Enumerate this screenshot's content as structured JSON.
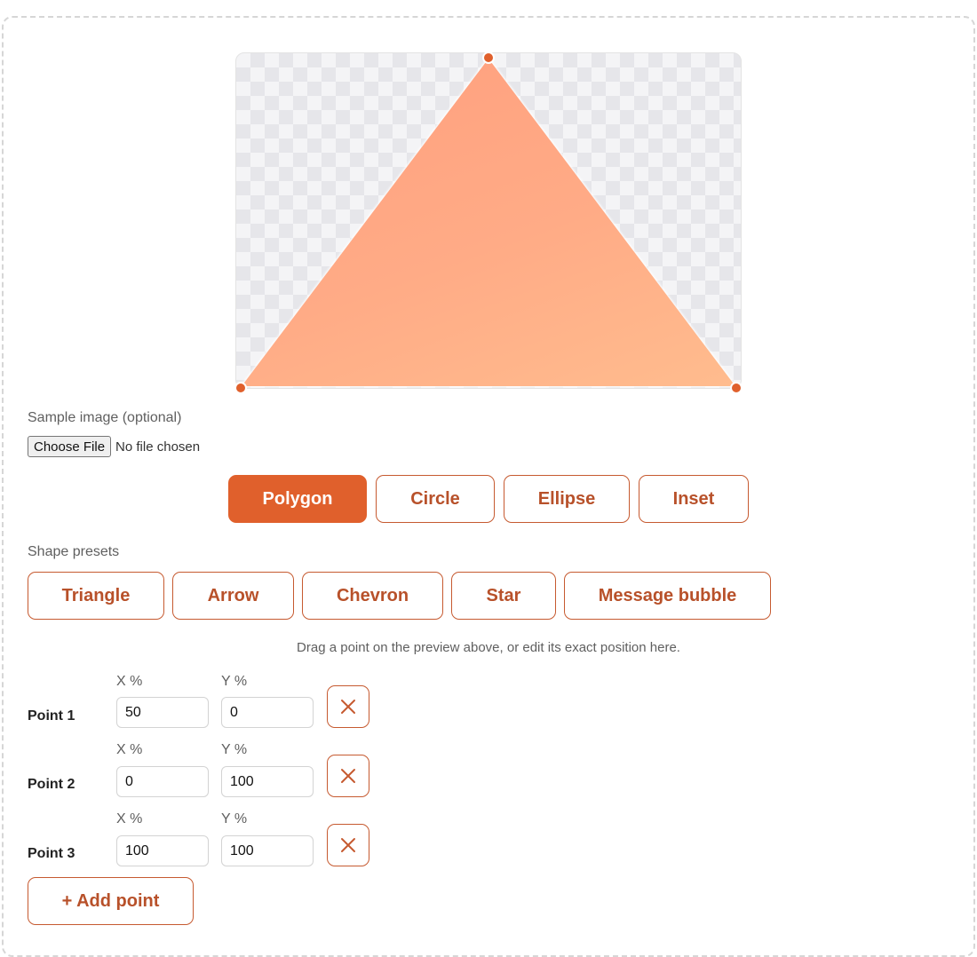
{
  "preview": {
    "shape": "polygon",
    "points": [
      [
        50,
        0
      ],
      [
        0,
        100
      ],
      [
        100,
        100
      ]
    ],
    "fill_colors": [
      "#ff9f7e",
      "#ffbc8e"
    ],
    "handle_color": "#e0602c"
  },
  "file_input": {
    "label": "Sample image (optional)",
    "button_label": "Choose File",
    "status": "No file chosen"
  },
  "shape_types": {
    "active_index": 0,
    "items": [
      "Polygon",
      "Circle",
      "Ellipse",
      "Inset"
    ]
  },
  "presets": {
    "label": "Shape presets",
    "items": [
      "Triangle",
      "Arrow",
      "Chevron",
      "Star",
      "Message bubble"
    ]
  },
  "hint": "Drag a point on the preview above, or edit its exact position here.",
  "points_editor": {
    "x_label": "X %",
    "y_label": "Y %",
    "points": [
      {
        "label": "Point 1",
        "x": "50",
        "y": "0"
      },
      {
        "label": "Point 2",
        "x": "0",
        "y": "100"
      },
      {
        "label": "Point 3",
        "x": "100",
        "y": "100"
      }
    ],
    "add_label": "+ Add point"
  },
  "colors": {
    "accent": "#e0602c",
    "accent_text": "#b8512a"
  }
}
